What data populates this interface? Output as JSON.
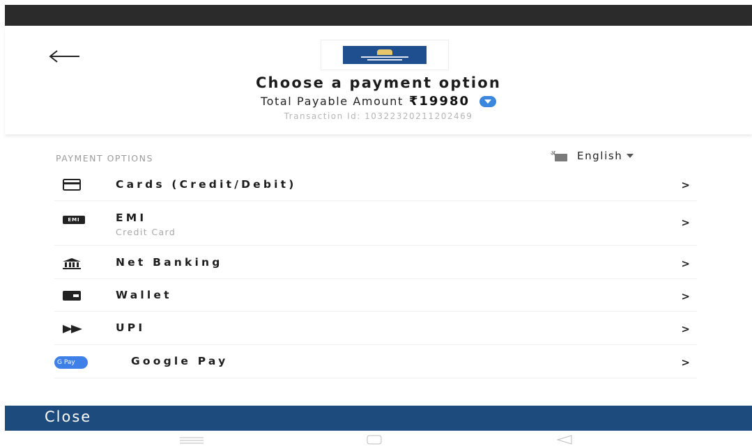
{
  "header": {
    "back_icon": "arrow-left-icon",
    "logo": "merchant-logo",
    "title": "Choose a payment option",
    "amount_label": "Total Payable Amount",
    "amount_value": "₹19980",
    "amount_toggle_icon": "chevron-down-icon",
    "transaction": "Transaction Id: 103223202112024­69"
  },
  "options": {
    "header": "PAYMENT OPTIONS",
    "language": {
      "icon": "translate-icon",
      "label": "English"
    },
    "items": [
      {
        "icon": "card-icon",
        "label": "Cards (Credit/Debit)",
        "chevron": ">"
      },
      {
        "icon": "emi-icon",
        "icon_text": "EMI",
        "label": "EMI",
        "sublabel": "Credit Card",
        "chevron": ">"
      },
      {
        "icon": "bank-icon",
        "label": "Net Banking",
        "chevron": ">"
      },
      {
        "icon": "wallet-icon",
        "label": "Wallet",
        "chevron": ">"
      },
      {
        "icon": "upi-icon",
        "label": "UPI",
        "chevron": ">"
      },
      {
        "icon": "google-pay-icon",
        "icon_text": "G Pay",
        "label": "Google Pay",
        "chevron": ">"
      }
    ]
  },
  "footer": {
    "close_label": "Close"
  },
  "system_nav": {
    "menu_icon": "menu-icon",
    "home_icon": "home-icon",
    "back_icon": "back-triangle-icon"
  },
  "colors": {
    "accent": "#1d4b7e",
    "toggle": "#3b86de",
    "status_bar": "#2b2b2b"
  }
}
